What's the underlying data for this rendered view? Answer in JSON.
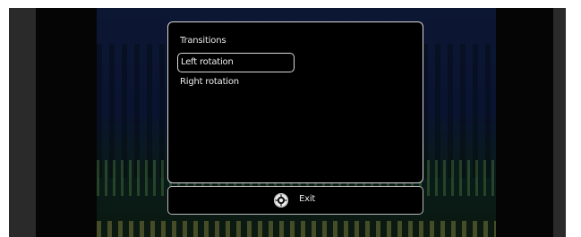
{
  "dialog": {
    "title": "Transitions",
    "options": [
      {
        "label": "Left rotation",
        "selected": true
      },
      {
        "label": "Right rotation",
        "selected": false
      }
    ]
  },
  "footer": {
    "exit_icon": "controller-button-icon",
    "exit_label": "Exit"
  }
}
